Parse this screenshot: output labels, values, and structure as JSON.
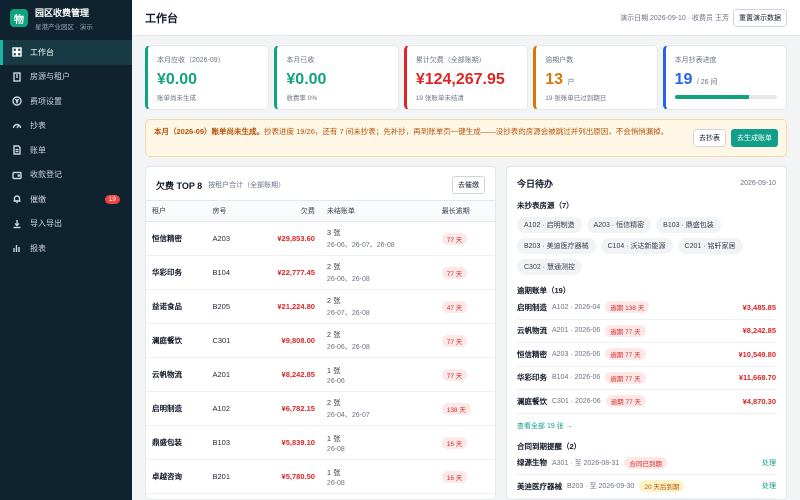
{
  "brand": {
    "logo_char": "物",
    "title": "园区收费管理",
    "subtitle": "星港产业园区 · 演示"
  },
  "sidebar": {
    "items": [
      {
        "label": "工作台",
        "icon": "grid-icon",
        "active": true
      },
      {
        "label": "房源与租户",
        "icon": "building-icon"
      },
      {
        "label": "费项设置",
        "icon": "yen-icon"
      },
      {
        "label": "抄表",
        "icon": "gauge-icon"
      },
      {
        "label": "账单",
        "icon": "document-icon"
      },
      {
        "label": "收款登记",
        "icon": "wallet-icon"
      },
      {
        "label": "催缴",
        "icon": "bell-icon",
        "badge": "19"
      },
      {
        "label": "导入导出",
        "icon": "download-icon"
      },
      {
        "label": "报表",
        "icon": "bar-chart-icon"
      }
    ]
  },
  "header": {
    "title": "工作台",
    "demo_date": "演示日期 2026-09-10 · 收费员 王芳",
    "reset_label": "重置演示数据"
  },
  "stats": [
    {
      "label": "本月应收（2026-09）",
      "value": "¥0.00",
      "sub": "账单尚未生成",
      "color": "#10a37f"
    },
    {
      "label": "本月已收",
      "value": "¥0.00",
      "sub": "收费率 0%",
      "color": "#10a37f"
    },
    {
      "label": "累计欠费（全部账期）",
      "value": "¥124,267.95",
      "sub": "19 张账单未结清",
      "color": "#dc2626"
    },
    {
      "label": "逾期户数",
      "value": "13",
      "unit": "户",
      "sub": "19 张账单已过到期日",
      "color": "#d97706"
    },
    {
      "label": "本月抄表进度",
      "value": "19",
      "unit": "/ 26 间",
      "color": "#2563eb",
      "progress": 0.73
    }
  ],
  "alert": {
    "bold": "本月（2026-09）账单尚未生成。",
    "text": "抄表进度 19/26，还有 7 间未抄表；先补抄，再到账单页一键生成——没抄表的房源会被跳过并列出原因，不会悄悄漏掉。",
    "go_meter_label": "去抄表",
    "generate_label": "去生成账单"
  },
  "arrears": {
    "title": "欠费 TOP 8",
    "subtitle": "按租户合计（全部账期）",
    "action_label": "去催缴",
    "columns": [
      "租户",
      "房号",
      "欠费",
      "未结账单",
      "最长逾期"
    ],
    "rows": [
      {
        "tenant": "恒信精密",
        "room": "A203",
        "amount": "¥29,853.60",
        "bills": "3 张",
        "months": "26-06、26-07、26-08",
        "overdue": "77 天"
      },
      {
        "tenant": "华彩印务",
        "room": "B104",
        "amount": "¥22,777.45",
        "bills": "2 张",
        "months": "26-06、26-08",
        "overdue": "77 天"
      },
      {
        "tenant": "益诺食品",
        "room": "B205",
        "amount": "¥21,224.80",
        "bills": "2 张",
        "months": "26-07、26-08",
        "overdue": "47 天"
      },
      {
        "tenant": "澜庭餐饮",
        "room": "C301",
        "amount": "¥9,808.00",
        "bills": "2 张",
        "months": "26-06、26-08",
        "overdue": "77 天"
      },
      {
        "tenant": "云帆物流",
        "room": "A201",
        "amount": "¥8,242.85",
        "bills": "1 张",
        "months": "26-06",
        "overdue": "77 天"
      },
      {
        "tenant": "启明制造",
        "room": "A102",
        "amount": "¥6,782.15",
        "bills": "2 张",
        "months": "26-04、26-07",
        "overdue": "138 天"
      },
      {
        "tenant": "鼎盛包装",
        "room": "B103",
        "amount": "¥5,839.10",
        "bills": "1 张",
        "months": "26-08",
        "overdue": "16 天"
      },
      {
        "tenant": "卓越咨询",
        "room": "B201",
        "amount": "¥5,780.50",
        "bills": "1 张",
        "months": "26-08",
        "overdue": "16 天"
      }
    ]
  },
  "todo": {
    "title": "今日待办",
    "date": "2026-09-10",
    "unread_title": "未抄表房源（7）",
    "unread_chips": [
      "A102 · 启明制造",
      "A203 · 恒信精密",
      "B103 · 鼎盛包装",
      "B203 · 美迪医疗器械",
      "C104 · 沃达新能源",
      "C201 · 铭轩家居",
      "C302 · 慧通测控"
    ],
    "overdue_title": "逾期账单（19）",
    "overdue_rows": [
      {
        "name": "启明制造",
        "meta": "A102 · 2026-04",
        "tag": "逾期 138 天",
        "amount": "¥3,485.85"
      },
      {
        "name": "云帆物流",
        "meta": "A201 · 2026-06",
        "tag": "逾期 77 天",
        "amount": "¥8,242.85"
      },
      {
        "name": "恒信精密",
        "meta": "A203 · 2026-06",
        "tag": "逾期 77 天",
        "amount": "¥10,549.80"
      },
      {
        "name": "华彩印务",
        "meta": "B104 · 2026-06",
        "tag": "逾期 77 天",
        "amount": "¥11,668.70"
      },
      {
        "name": "澜庭餐饮",
        "meta": "C301 · 2026-06",
        "tag": "逾期 77 天",
        "amount": "¥4,870.30"
      }
    ],
    "view_all": "查看全部 19 张 →",
    "contract_title": "合同到期提醒（2）",
    "contract_rows": [
      {
        "name": "绿源生物",
        "meta": "A301 · 至 2026-08-31",
        "tag": "合同已到期",
        "tag_style": "red",
        "action": "处理"
      },
      {
        "name": "美迪医疗器械",
        "meta": "B203 · 至 2026-09-30",
        "tag": "20 天后到期",
        "tag_style": "amber",
        "action": "处理"
      }
    ]
  }
}
